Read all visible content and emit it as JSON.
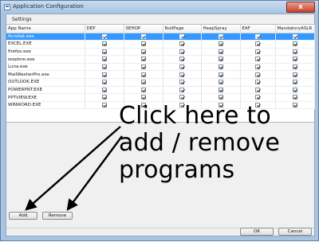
{
  "window": {
    "title": "Application Configuration",
    "close_label": "x"
  },
  "tabs": {
    "settings": "Settings"
  },
  "grid": {
    "columns": [
      "App Name",
      "DEP",
      "SEHOP",
      "NullPage",
      "HeapSpray",
      "EAF",
      "MandatoryASLR"
    ],
    "rows": [
      {
        "name": "Acrobat.exe",
        "selected": true
      },
      {
        "name": "EXCEL.EXE"
      },
      {
        "name": "firefox.exe"
      },
      {
        "name": "iexplore.exe"
      },
      {
        "name": "Luna.exe"
      },
      {
        "name": "MailWasherPro.exe"
      },
      {
        "name": "OUTLOOK.EXE"
      },
      {
        "name": "POWERPNT.EXE"
      },
      {
        "name": "PPTVIEW.EXE"
      },
      {
        "name": "WINWORD.EXE"
      }
    ],
    "all_checked": true
  },
  "annotation": {
    "text": "Click here to\nadd / remove\nprograms"
  },
  "buttons": {
    "add": "Add",
    "remove": "Remove",
    "ok": "OK",
    "cancel": "Cancel"
  },
  "colors": {
    "selection": "#3399ff",
    "window_frame": "#a8c4e2",
    "close_button": "#c7402b"
  }
}
